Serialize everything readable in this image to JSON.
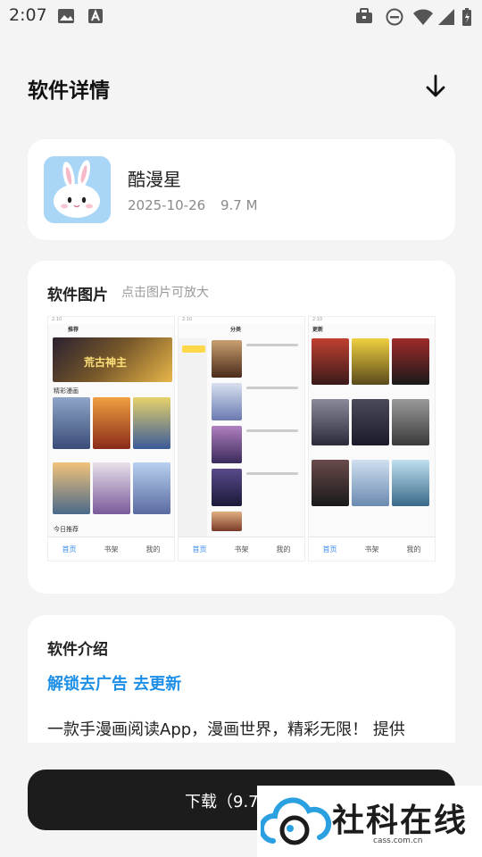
{
  "status_bar": {
    "time": "2:07"
  },
  "header": {
    "title": "软件详情"
  },
  "app": {
    "name": "酷漫星",
    "date": "2025-10-26",
    "size": "9.7 M"
  },
  "screenshots": {
    "title": "软件图片",
    "hint": "点击图片可放大",
    "shots": [
      {
        "tab": "推荐",
        "section": "精彩漫画",
        "section2": "今日推荐",
        "banner": "荒古神主",
        "nav": [
          "首页",
          "书架",
          "我的"
        ]
      },
      {
        "tab": "分类",
        "nav": [
          "首页",
          "书架",
          "我的"
        ]
      },
      {
        "tab": "更新",
        "nav": [
          "首页",
          "书架",
          "我的"
        ]
      }
    ]
  },
  "intro": {
    "title": "软件介绍",
    "link": "解锁去广告 去更新",
    "text": "一款手漫画阅读App，漫画世界，精彩无限！ 提供"
  },
  "download": {
    "label": "下载（9.7"
  },
  "watermark": {
    "text": "社科在线",
    "url": "cass.com.cn"
  }
}
